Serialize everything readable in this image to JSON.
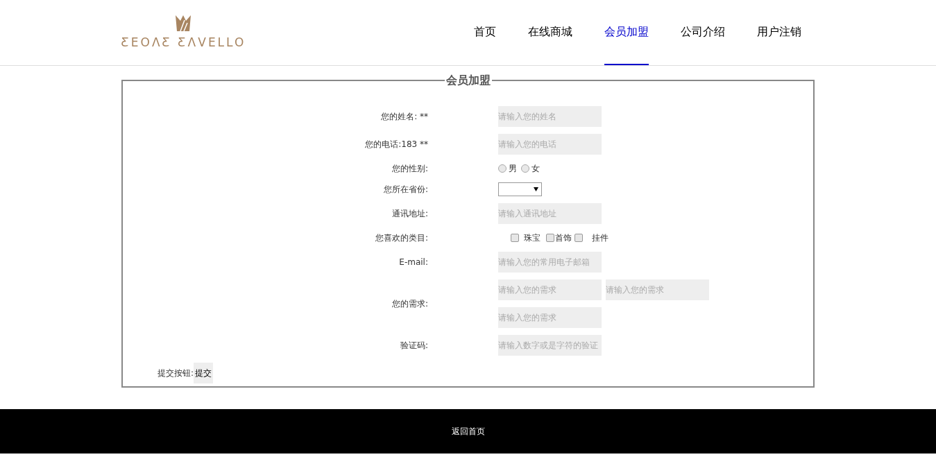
{
  "logo": {
    "text": "ƸEOΛƸ ƸΛVELLO"
  },
  "nav": [
    {
      "label": "首页",
      "selected": false
    },
    {
      "label": "在线商城",
      "selected": false
    },
    {
      "label": "会员加盟",
      "selected": true
    },
    {
      "label": "公司介绍",
      "selected": false
    },
    {
      "label": "用户注销",
      "selected": false
    }
  ],
  "form": {
    "legend": "会员加盟",
    "rows": [
      {
        "kind": "text",
        "label": "您的姓名: **",
        "fields": [
          {
            "placeholder": "请输入您的姓名"
          }
        ]
      },
      {
        "kind": "text",
        "label": "您的电话:183 **",
        "fields": [
          {
            "placeholder": "请输入您的电话"
          }
        ]
      },
      {
        "kind": "radio",
        "label": "您的性别:",
        "options": [
          {
            "label": "男",
            "selected": false
          },
          {
            "label": "女",
            "selected": false
          }
        ]
      },
      {
        "kind": "select",
        "label": "您所在省份:"
      },
      {
        "kind": "text",
        "label": "通讯地址:",
        "fields": [
          {
            "placeholder": "请输入通讯地址"
          }
        ]
      },
      {
        "kind": "checkbox",
        "label": "您喜欢的类目:",
        "options": [
          {
            "label": "珠宝",
            "checked": false
          },
          {
            "label": "首饰",
            "checked": false
          },
          {
            "label": "挂件",
            "checked": false
          }
        ]
      },
      {
        "kind": "text",
        "label": "E-mail:",
        "fields": [
          {
            "placeholder": "请输入您的常用电子邮箱"
          }
        ]
      },
      {
        "kind": "text",
        "label": "您的需求:",
        "fields": [
          {
            "placeholder": "请输入您的需求"
          },
          {
            "placeholder": "请输入您的需求"
          },
          {
            "placeholder": "请输入您的需求"
          }
        ]
      },
      {
        "kind": "text",
        "label": "验证码:",
        "fields": [
          {
            "placeholder": "请输入数字或是字符的验证"
          }
        ]
      }
    ],
    "submit": {
      "label": "提交按钮:",
      "button": "提交"
    }
  },
  "footer": {
    "link": "返回首页"
  }
}
